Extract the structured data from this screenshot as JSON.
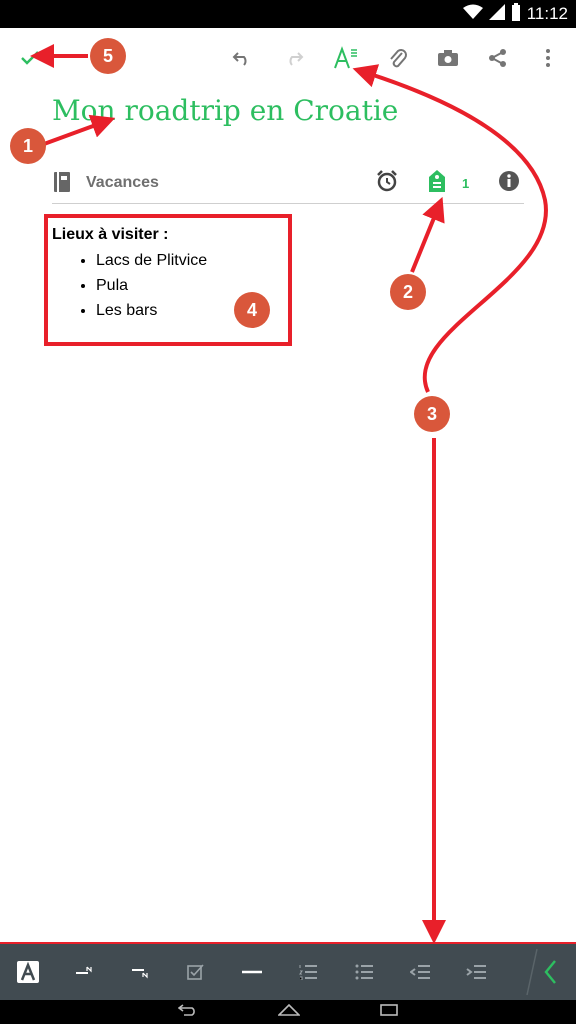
{
  "status_bar": {
    "time": "11:12"
  },
  "note": {
    "title": "Mon roadtrip en Croatie",
    "notebook": "Vacances",
    "tag_count": "1",
    "content": {
      "heading": "Lieux à visiter :",
      "items": [
        "Lacs de Plitvice",
        "Pula",
        "Les bars"
      ]
    }
  },
  "annotations": [
    "1",
    "2",
    "3",
    "4",
    "5"
  ],
  "colors": {
    "accent": "#2dbe60",
    "annotation_red": "#e8202a",
    "badge": "#d9573b",
    "format_bar": "#414b51"
  }
}
